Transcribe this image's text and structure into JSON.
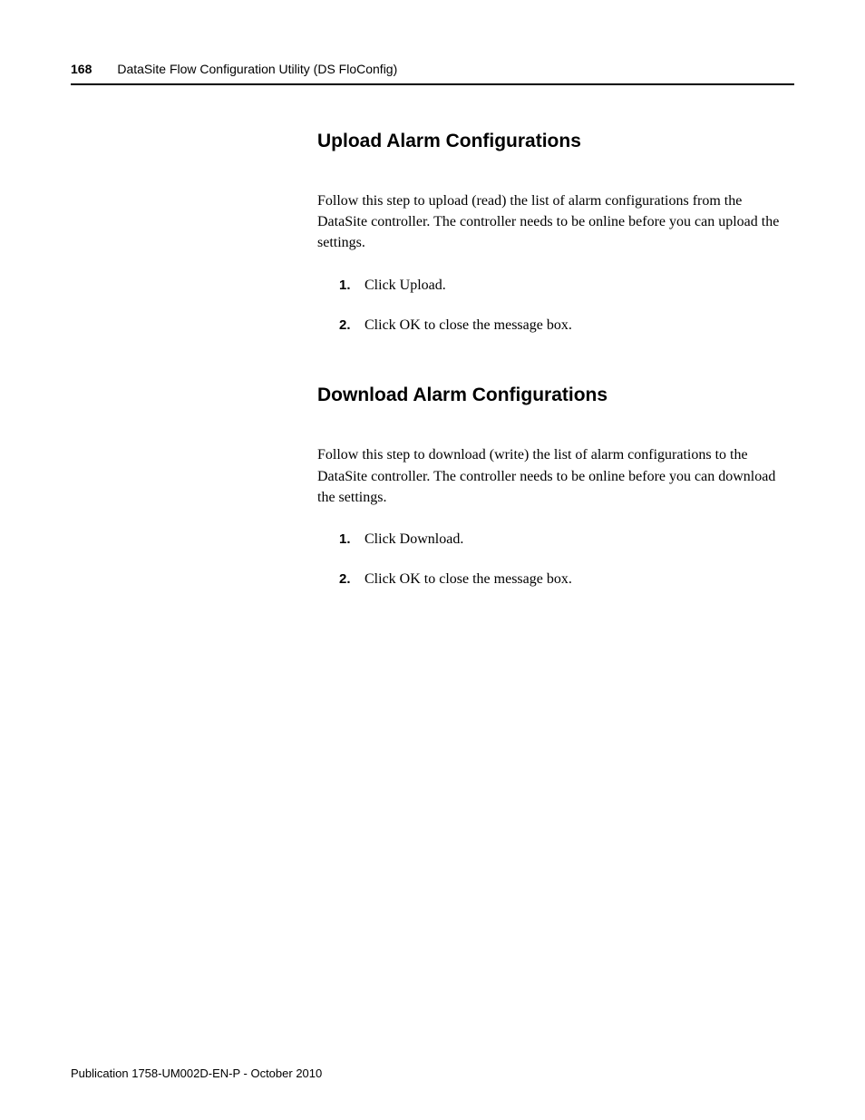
{
  "header": {
    "page_number": "168",
    "title": "DataSite Flow Configuration Utility (DS FloConfig)"
  },
  "sections": [
    {
      "heading": "Upload Alarm Configurations",
      "paragraph": "Follow this step to upload (read) the list of alarm configurations from the DataSite controller. The controller needs to be online before you can upload the settings.",
      "steps": [
        {
          "num": "1.",
          "text": "Click Upload."
        },
        {
          "num": "2.",
          "text": "Click OK to close the message box."
        }
      ]
    },
    {
      "heading": "Download Alarm Configurations",
      "paragraph": "Follow this step to download (write) the list of alarm configurations to the DataSite controller. The controller needs to be online before you can download the settings.",
      "steps": [
        {
          "num": "1.",
          "text": "Click Download."
        },
        {
          "num": "2.",
          "text": "Click OK to close the message box."
        }
      ]
    }
  ],
  "footer": {
    "text": "Publication 1758-UM002D-EN-P - October 2010"
  }
}
